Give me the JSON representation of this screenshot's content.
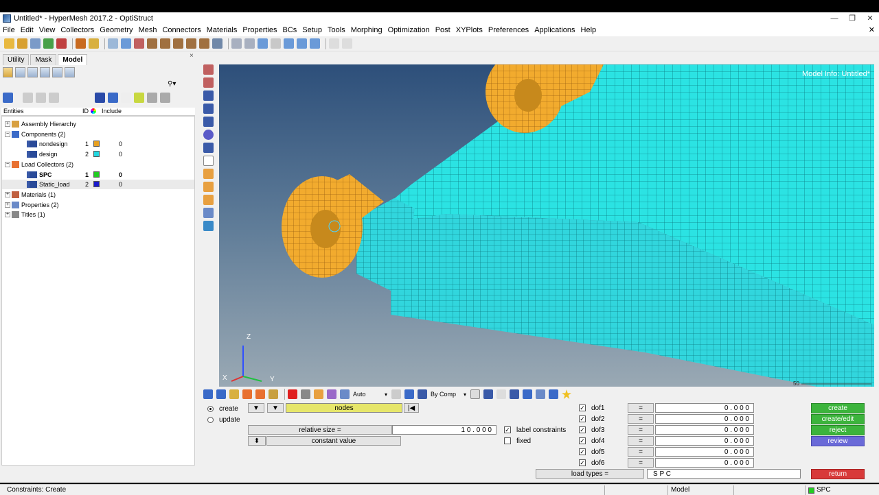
{
  "window": {
    "title": "Untitled* - HyperMesh 2017.2 - OptiStruct",
    "controls": [
      "—",
      "❒",
      "✕"
    ]
  },
  "menu": [
    "File",
    "Edit",
    "View",
    "Collectors",
    "Geometry",
    "Mesh",
    "Connectors",
    "Materials",
    "Properties",
    "BCs",
    "Setup",
    "Tools",
    "Morphing",
    "Optimization",
    "Post",
    "XYPlots",
    "Preferences",
    "Applications",
    "Help"
  ],
  "menu_close": "✕",
  "tabs": [
    "Utility",
    "Mask",
    "Model"
  ],
  "tab_close": "×",
  "search_glyph": "⚲▾",
  "columns": {
    "entities": "Entities",
    "id": "ID",
    "include": "Include"
  },
  "tree": [
    {
      "label": "Assembly Hierarchy",
      "level": 0,
      "exp": "+",
      "icon": "assembly-icon"
    },
    {
      "label": "Components (2)",
      "level": 0,
      "exp": "−",
      "icon": "components-folder-icon"
    },
    {
      "label": "nondesign",
      "level": 1,
      "id": "1",
      "color": "#e8a020",
      "include": "0",
      "icon": "component-icon"
    },
    {
      "label": "design",
      "level": 1,
      "id": "2",
      "color": "#22d8e0",
      "include": "0",
      "icon": "component-icon"
    },
    {
      "label": "Load Collectors (2)",
      "level": 0,
      "exp": "−",
      "icon": "loadcol-folder-icon"
    },
    {
      "label": "SPC",
      "level": 1,
      "id": "1",
      "color": "#22cc22",
      "include": "0",
      "bold": true,
      "icon": "loadcol-icon"
    },
    {
      "label": "Static_load",
      "level": 1,
      "id": "2",
      "color": "#1a1acc",
      "include": "0",
      "sel": true,
      "icon": "loadcol-icon"
    },
    {
      "label": "Materials (1)",
      "level": 0,
      "exp": "+",
      "icon": "materials-folder-icon"
    },
    {
      "label": "Properties (2)",
      "level": 0,
      "exp": "+",
      "icon": "properties-folder-icon"
    },
    {
      "label": "Titles (1)",
      "level": 0,
      "exp": "+",
      "icon": "titles-folder-icon"
    }
  ],
  "viewport": {
    "model_info": "Model Info: Untitled*",
    "axes": {
      "z": "Z",
      "y": "Y",
      "x": "X"
    },
    "scale": "50"
  },
  "tool_strip": {
    "display_mode": "Auto",
    "color_by": "By Comp"
  },
  "panel": {
    "mode_options": [
      "create",
      "update"
    ],
    "selected_mode": "create",
    "entity_selector": "nodes",
    "relative_size_label": "relative size =",
    "relative_size_value": "1 0 . 0 0 0",
    "label_constraints": "label constraints",
    "label_constraints_checked": true,
    "fixed": "fixed",
    "fixed_checked": false,
    "constant_value": "constant value",
    "dofs": [
      {
        "label": "dof1",
        "checked": true,
        "eq": "=",
        "value": "0 . 0 0 0"
      },
      {
        "label": "dof2",
        "checked": true,
        "eq": "=",
        "value": "0 . 0 0 0"
      },
      {
        "label": "dof3",
        "checked": true,
        "eq": "=",
        "value": "0 . 0 0 0"
      },
      {
        "label": "dof4",
        "checked": true,
        "eq": "=",
        "value": "0 . 0 0 0"
      },
      {
        "label": "dof5",
        "checked": true,
        "eq": "=",
        "value": "0 . 0 0 0"
      },
      {
        "label": "dof6",
        "checked": true,
        "eq": "=",
        "value": "0 . 0 0 0"
      }
    ],
    "load_types_label": "load types =",
    "load_types_value": "S P C",
    "buttons": {
      "create": "create",
      "create_edit": "create/edit",
      "reject": "reject",
      "review": "review",
      "return": "return"
    },
    "colors": {
      "green": "#3cb43c",
      "review": "#6a6ad8",
      "return": "#d83a3a",
      "nodes_field": "#e6e66a"
    }
  },
  "status": {
    "left": "Constraints: Create",
    "model": "Model",
    "collector": "SPC",
    "collector_color": "#22cc22"
  }
}
